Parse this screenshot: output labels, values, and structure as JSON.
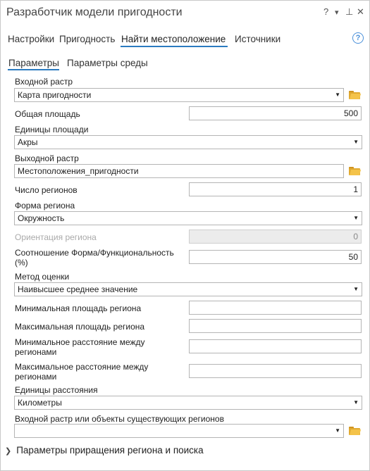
{
  "window": {
    "title": "Разработчик модели пригодности",
    "controls": {
      "help": "?",
      "menu": "▾",
      "pin": "⊥",
      "close": "✕"
    }
  },
  "tabs": [
    {
      "label": "Настройки",
      "active": false
    },
    {
      "label": "Пригодность",
      "active": false
    },
    {
      "label": "Найти местоположение",
      "active": true
    },
    {
      "label": "Источники",
      "active": false
    }
  ],
  "help_icon": "?",
  "subtabs": [
    {
      "label": "Параметры",
      "active": true
    },
    {
      "label": "Параметры среды",
      "active": false
    }
  ],
  "params": {
    "input_raster": {
      "label": "Входной растр",
      "value": "Карта пригодности"
    },
    "total_area": {
      "label": "Общая площадь",
      "value": "500"
    },
    "area_units": {
      "label": "Единицы площади",
      "value": "Акры"
    },
    "output_raster": {
      "label": "Выходной растр",
      "value": "Местоположения_пригодности"
    },
    "num_regions": {
      "label": "Число регионов",
      "value": "1"
    },
    "region_shape": {
      "label": "Форма региона",
      "value": "Окружность"
    },
    "region_orientation": {
      "label": "Ориентация региона",
      "value": "0",
      "disabled": true
    },
    "shape_tradeoff": {
      "label": "Соотношение Форма/Функциональность (%)",
      "value": "50"
    },
    "evaluation_method": {
      "label": "Метод оценки",
      "value": "Наивысшее среднее значение"
    },
    "min_region_area": {
      "label": "Минимальная площадь региона",
      "value": ""
    },
    "max_region_area": {
      "label": "Максимальная площадь региона",
      "value": ""
    },
    "min_distance": {
      "label": "Минимальное расстояние между регионами",
      "value": ""
    },
    "max_distance": {
      "label": "Максимальное расстояние между регионами",
      "value": ""
    },
    "distance_units": {
      "label": "Единицы расстояния",
      "value": "Километры"
    },
    "existing_regions": {
      "label": "Входной растр или объекты существующих регионов",
      "value": ""
    }
  },
  "expander": {
    "label": "Параметры приращения региона и поиска"
  },
  "colors": {
    "accent": "#2b7bc0",
    "folder": "#f4c34a"
  }
}
